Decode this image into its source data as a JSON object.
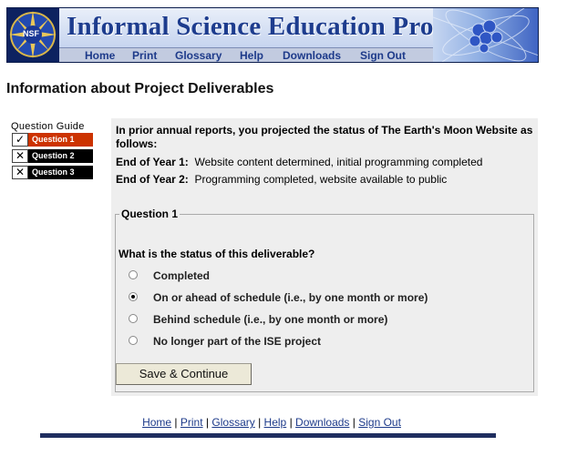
{
  "app": {
    "title": "Informal Science Education Program",
    "logo_text": "NSF"
  },
  "menu": [
    {
      "label": "Home"
    },
    {
      "label": "Print"
    },
    {
      "label": "Glossary"
    },
    {
      "label": "Help"
    },
    {
      "label": "Downloads"
    },
    {
      "label": "Sign Out"
    }
  ],
  "page": {
    "title": "Information about Project Deliverables"
  },
  "guide": {
    "title": "Question Guide",
    "items": [
      {
        "label": "Question 1",
        "mark": "check-icon",
        "mark_glyph": "✓",
        "color": "#cc3300"
      },
      {
        "label": "Question 2",
        "mark": "x-icon",
        "mark_glyph": "✕",
        "color": "#000000"
      },
      {
        "label": "Question 3",
        "mark": "x-icon",
        "mark_glyph": "✕",
        "color": "#000000"
      }
    ]
  },
  "intro": {
    "text": "In prior annual reports, you projected the status of The Earth's Moon Website as follows:",
    "years": [
      {
        "label": "End of Year 1:",
        "value": "Website content determined, initial programming completed"
      },
      {
        "label": "End of Year 2:",
        "value": "Programming completed, website available to public"
      }
    ]
  },
  "question": {
    "legend": "Question 1",
    "prompt": "What is the status of this deliverable?",
    "options": [
      {
        "label": "Completed",
        "selected": false
      },
      {
        "label": "On or ahead of schedule (i.e., by one month or more)",
        "selected": true
      },
      {
        "label": "Behind schedule (i.e., by one month or more)",
        "selected": false
      },
      {
        "label": "No longer part of the ISE project",
        "selected": false
      }
    ],
    "submit_label": "Save & Continue"
  },
  "footer": {
    "links": [
      "Home",
      "Print",
      "Glossary",
      "Help",
      "Downloads",
      "Sign Out"
    ],
    "separator": "|"
  },
  "colors": {
    "brand_navy": "#1f3d8a",
    "current_question": "#cc3300",
    "panel_bg": "#eeeeee"
  }
}
